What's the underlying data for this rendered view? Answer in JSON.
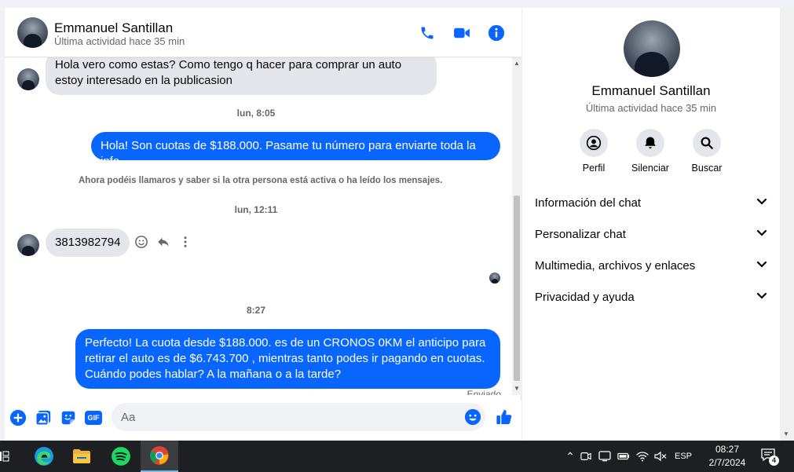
{
  "contact": {
    "name": "Emmanuel Santillan",
    "status": "Última actividad hace 35 min"
  },
  "header_icons": [
    "phone-icon",
    "video-icon",
    "info-icon"
  ],
  "messages": {
    "first_incoming": "Hola vero como estas? Como tengo q hacer para comprar un auto estoy interesado en la publicasion",
    "ts1": "lun, 8:05",
    "outgoing_1": "Hola! Son cuotas de $188.000. Pasame tu número para enviarte toda la info",
    "notice": "Ahora podéis llamaros y saber si la otra persona está activa o ha leído los mensajes.",
    "ts2": "lun, 12:11",
    "incoming_phone": "3813982794",
    "ts3": "8:27",
    "outgoing_2": "Perfecto! La cuota desde $188.000. es de un CRONOS 0KM el anticipo para retirar el auto es de $6.743.700 , mientras tanto podes ir pagando en cuotas. Cuándo podes hablar? A la mañana o a la tarde?",
    "delivery_status": "Enviado"
  },
  "composer": {
    "placeholder": "Aa",
    "gif_label": "GIF"
  },
  "info_panel": {
    "actions": [
      {
        "label": "Perfil",
        "icon": "profile-icon"
      },
      {
        "label": "Silenciar",
        "icon": "bell-icon"
      },
      {
        "label": "Buscar",
        "icon": "search-icon"
      }
    ],
    "sections": [
      "Información del chat",
      "Personalizar chat",
      "Multimedia, archivos y enlaces",
      "Privacidad y ayuda"
    ]
  },
  "taskbar": {
    "language": "ESP",
    "time": "08:27",
    "date": "2/7/2024",
    "notification_count": "4"
  },
  "colors": {
    "accent": "#0866ff",
    "incoming_bubble": "#e4e6eb",
    "taskbar": "#1e1f22"
  }
}
